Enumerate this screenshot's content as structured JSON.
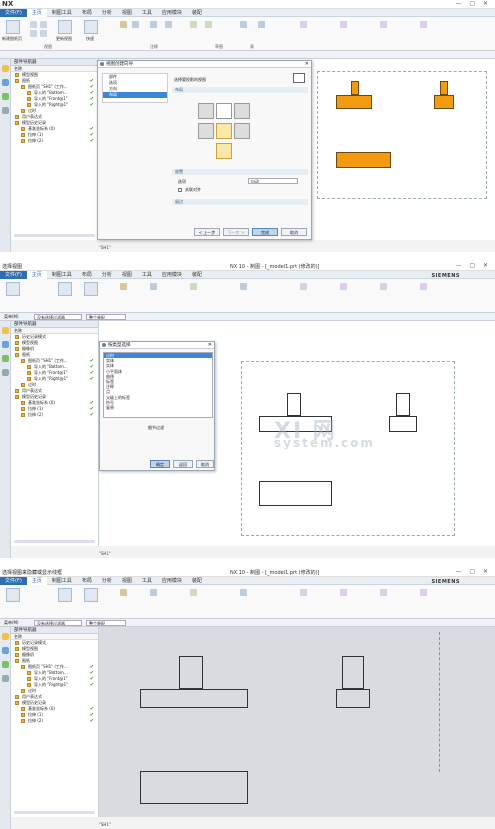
{
  "colors": {
    "accent": "#2e6db2",
    "siemens": "#0a8f9e",
    "part_fill": "#f29a10",
    "check": "#2a9a2a"
  },
  "panel1": {
    "menu": [
      "文件(F)",
      "主页",
      "制图工具",
      "布局",
      "分析",
      "视图",
      "工具",
      "应用模块",
      "装配"
    ],
    "ribbon_groups": [
      "视图",
      "注释",
      "草图",
      "表"
    ],
    "big_buttons": [
      "新建图纸页",
      "更新视图",
      "快速"
    ],
    "nav_header": "部件导航器",
    "nav_column": "名称",
    "tree": [
      "模型视图",
      "图纸",
      "图纸页 \"SH1\" (工作...",
      "导入的 \"Bottom...",
      "导入的 \"Front@1\"",
      "导入的 \"Right@1\"",
      "过时",
      "用户表达式",
      "模型历史记录",
      "基准坐标系 (0)",
      "拉伸 (1)",
      "拉伸 (2)"
    ],
    "dialog": {
      "title": "视图创建向导",
      "nav": [
        "部件",
        "选项",
        "方向",
        "布局"
      ],
      "nav_selected": 3,
      "prompt": "选择要投影的视图",
      "section_layout": "布局",
      "section_placement": "放置",
      "option_label": "选项",
      "option_value": "自动",
      "checkbox_label": "关联对齐",
      "section_margin": "留边",
      "buttons": [
        "< 上一步",
        "下一步 >",
        "完成",
        "取消"
      ]
    },
    "sheet_tab": "\"SH1\""
  },
  "panel2": {
    "title_left": "选择视图",
    "title": "NX 10 - 制图 - [_model1.prt (修改的)]",
    "menu": [
      "文件(F)",
      "主页",
      "制图工具",
      "布局",
      "分析",
      "视图",
      "工具",
      "应用模块",
      "装配"
    ],
    "filter_label": "菜单(M)",
    "filter_value": "没有选择过滤器",
    "filter_scope": "整个装配",
    "nav_header": "部件导航器",
    "nav_column": "名称",
    "tree": [
      "历史记录模式",
      "模型视图",
      "摄像机",
      "图纸",
      "图纸页 \"SH1\" (工作...",
      "导入的 \"Bottom...",
      "导入的 \"Front@1\"",
      "导入的 \"Right@1\"",
      "过时",
      "用户表达式",
      "模型历史记录",
      "基准坐标系 (0)",
      "拉伸 (1)",
      "拉伸 (2)"
    ],
    "dialog": {
      "title": "按类型选择",
      "items": [
        "过时",
        "实体",
        "实体",
        "小平面体",
        "曲线",
        "标签",
        "注释",
        "点",
        "父级上的标签",
        "符号",
        "复原"
      ],
      "selected": 0,
      "extra": "细节过滤",
      "buttons": [
        "确定",
        "返回",
        "取消"
      ]
    },
    "watermark": "XI 网",
    "watermark2": "system.com",
    "sheet_tab": "\"SH1\""
  },
  "panel3": {
    "title_left": "选择视图来隐藏或显示线框",
    "title": "NX 10 - 制图 - [_model1.prt (修改的)]",
    "menu": [
      "文件(F)",
      "主页",
      "制图工具",
      "布局",
      "分析",
      "视图",
      "工具",
      "应用模块",
      "装配"
    ],
    "filter_label": "菜单(M)",
    "filter_value": "没有选择过滤器",
    "filter_scope": "整个装配",
    "nav_header": "部件导航器",
    "nav_column": "名称",
    "tree": [
      "历史记录模式",
      "模型视图",
      "摄像机",
      "图纸",
      "图纸页 \"SH1\" (工作...",
      "导入的 \"Bottom...",
      "导入的 \"Front@1\"",
      "导入的 \"Right@1\"",
      "过时",
      "用户表达式",
      "模型历史记录",
      "基准坐标系 (0)",
      "拉伸 (1)",
      "拉伸 (2)"
    ],
    "sheet_tab": "\"SH1\""
  }
}
